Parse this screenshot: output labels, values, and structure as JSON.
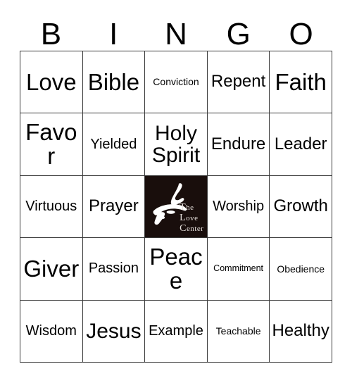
{
  "card": {
    "title": "Bingo Card",
    "header_letters": [
      "B",
      "I",
      "N",
      "G",
      "O"
    ],
    "colors": {
      "page_background": "#ffffff",
      "cell_background": "#ffffff",
      "grid_line": "#3a3a3a",
      "text": "#000000",
      "logo_background": "#190e0c",
      "logo_mark": "#ffffff",
      "logo_wordmark_text": "#e8e2de"
    },
    "rows": [
      [
        {
          "label": "Love",
          "size": "fs-xxl"
        },
        {
          "label": "Bible",
          "size": "fs-xxl"
        },
        {
          "label": "Conviction",
          "size": "fs-xs"
        },
        {
          "label": "Repent",
          "size": "fs-l"
        },
        {
          "label": "Faith",
          "size": "fs-xxl"
        }
      ],
      [
        {
          "label": "Favor",
          "size": "fs-xxl"
        },
        {
          "label": "Yielded",
          "size": "fs-m"
        },
        {
          "label": "Holy Spirit",
          "size": "fs-xl"
        },
        {
          "label": "Endure",
          "size": "fs-l"
        },
        {
          "label": "Leader",
          "size": "fs-l"
        }
      ],
      [
        {
          "label": "Virtuous",
          "size": "fs-m"
        },
        {
          "label": "Prayer",
          "size": "fs-l"
        },
        {
          "label": "",
          "size": "fs-m",
          "is_logo": true
        },
        {
          "label": "Worship",
          "size": "fs-m"
        },
        {
          "label": "Growth",
          "size": "fs-l"
        }
      ],
      [
        {
          "label": "Giver",
          "size": "fs-xxl"
        },
        {
          "label": "Passion",
          "size": "fs-m"
        },
        {
          "label": "Peace",
          "size": "fs-xxl"
        },
        {
          "label": "Commitment",
          "size": "fs-xxs"
        },
        {
          "label": "Obedience",
          "size": "fs-xs"
        }
      ],
      [
        {
          "label": "Wisdom",
          "size": "fs-m"
        },
        {
          "label": "Jesus",
          "size": "fs-xl"
        },
        {
          "label": "Example",
          "size": "fs-m"
        },
        {
          "label": "Teachable",
          "size": "fs-xs"
        },
        {
          "label": "Healthy",
          "size": "fs-l"
        }
      ]
    ],
    "free_space": {
      "name": "the-love-center-logo",
      "wordmark_lines": [
        "The",
        "Love",
        "Center"
      ]
    }
  }
}
